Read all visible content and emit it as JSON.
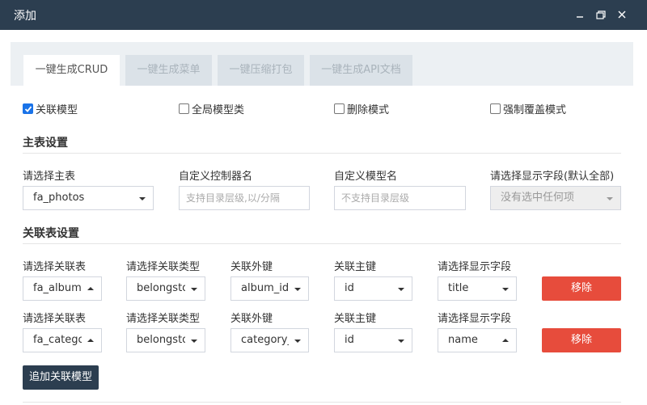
{
  "window": {
    "title": "添加"
  },
  "tabs": [
    {
      "label": "一键生成CRUD",
      "active": true
    },
    {
      "label": "一键生成菜单",
      "active": false
    },
    {
      "label": "一键压缩打包",
      "active": false
    },
    {
      "label": "一键生成API文档",
      "active": false
    }
  ],
  "options": [
    {
      "label": "关联模型",
      "checked": true
    },
    {
      "label": "全局模型类",
      "checked": false
    },
    {
      "label": "删除模式",
      "checked": false
    },
    {
      "label": "强制覆盖模式",
      "checked": false
    }
  ],
  "main_settings": {
    "title": "主表设置",
    "table_label": "请选择主表",
    "table_value": "fa_photos",
    "controller_label": "自定义控制器名",
    "controller_placeholder": "支持目录层级,以/分隔",
    "model_label": "自定义模型名",
    "model_placeholder": "不支持目录层级",
    "fields_label": "请选择显示字段(默认全部)",
    "fields_value": "没有选中任何项"
  },
  "relation_settings": {
    "title": "关联表设置",
    "rows": [
      {
        "table_label": "请选择关联表",
        "table_value": "fa_album",
        "type_label": "请选择关联类型",
        "type_value": "belongsto",
        "fk_label": "关联外键",
        "fk_value": "album_id",
        "pk_label": "关联主键",
        "pk_value": "id",
        "field_label": "请选择显示字段",
        "field_value": "title",
        "remove_label": "移除"
      },
      {
        "table_label": "请选择关联表",
        "table_value": "fa_category",
        "type_label": "请选择关联类型",
        "type_value": "belongsto",
        "fk_label": "关联外键",
        "fk_value": "category_id",
        "pk_label": "关联主键",
        "pk_value": "id",
        "field_label": "请选择显示字段",
        "field_value": "name",
        "remove_label": "移除"
      }
    ],
    "add_label": "追加关联模型"
  }
}
